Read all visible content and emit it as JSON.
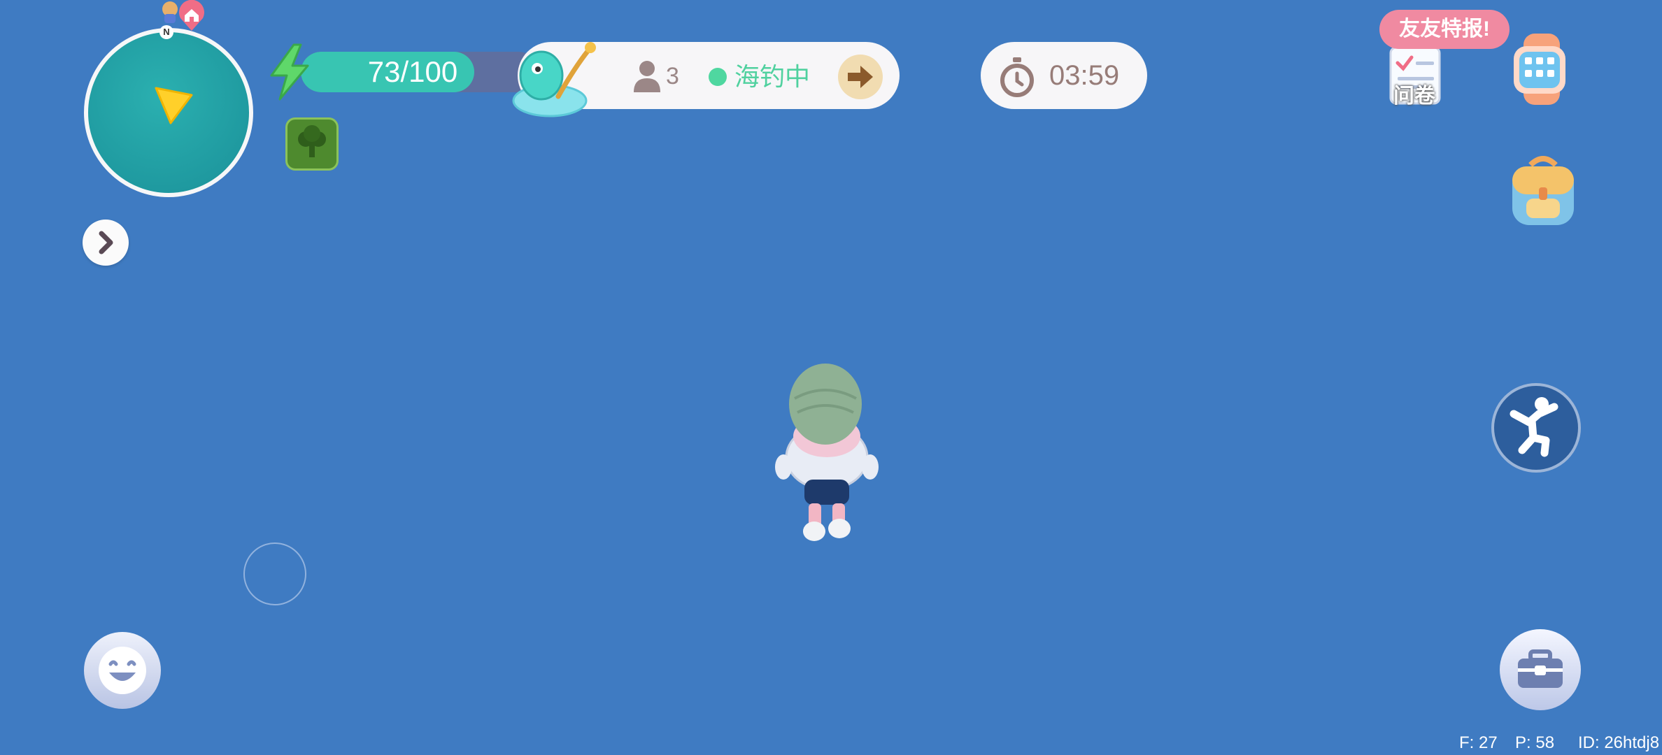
{
  "hud": {
    "energy": {
      "current": 73,
      "max": 100,
      "label": "73/100"
    },
    "activity": {
      "player_count": "3",
      "status": "海钓中",
      "status_color": "#4fd7a0"
    },
    "timer": {
      "value": "03:59"
    }
  },
  "right_menu": {
    "news_bubble": "友友特报!",
    "survey_label": "问卷"
  },
  "minimap": {
    "north_label": "N"
  },
  "debug": {
    "f": "F: 27",
    "p": "P: 58",
    "id": "ID: 26htdj8"
  },
  "icons": [
    "lightning-icon",
    "broccoli-icon",
    "fish-rod-icon",
    "person-icon",
    "arrow-right-icon",
    "stopwatch-icon",
    "survey-icon",
    "smartwatch-icon",
    "backpack-icon",
    "pose-icon",
    "toolbox-icon",
    "smile-icon",
    "chevron-right-icon",
    "home-pin-icon",
    "player-arrow-icon"
  ],
  "colors": {
    "water": "#3f7bc2",
    "energy_fill": "#38c5b2",
    "minimap": "#1f9aa0"
  }
}
